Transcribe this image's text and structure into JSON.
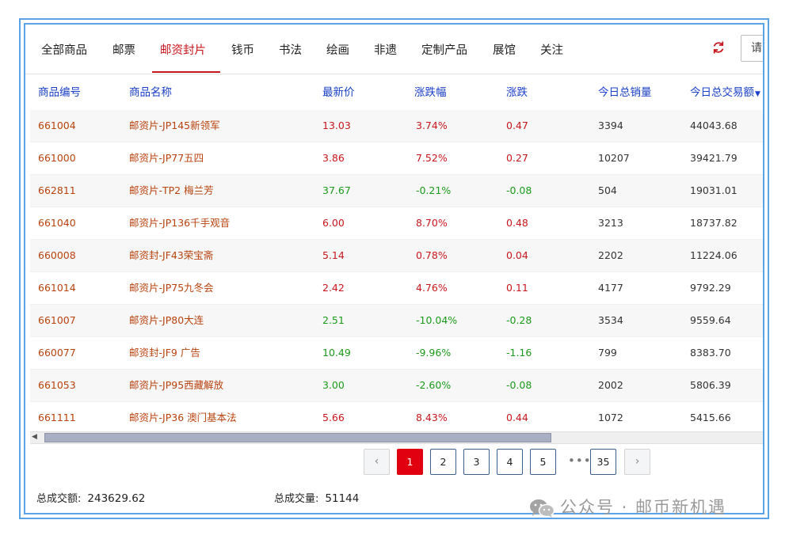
{
  "tabs": [
    {
      "label": "全部商品",
      "active": false
    },
    {
      "label": "邮票",
      "active": false
    },
    {
      "label": "邮资封片",
      "active": true
    },
    {
      "label": "钱币",
      "active": false
    },
    {
      "label": "书法",
      "active": false
    },
    {
      "label": "绘画",
      "active": false
    },
    {
      "label": "非遗",
      "active": false
    },
    {
      "label": "定制产品",
      "active": false
    },
    {
      "label": "展馆",
      "active": false
    },
    {
      "label": "关注",
      "active": false
    }
  ],
  "search": {
    "partial_text": "请"
  },
  "table": {
    "headers": [
      "商品编号",
      "商品名称",
      "最新价",
      "涨跌幅",
      "涨跌",
      "今日总销量",
      "今日总交易额"
    ],
    "rows": [
      {
        "code": "661004",
        "name": "邮资片-JP145新领军",
        "price": "13.03",
        "pct": "3.74%",
        "chg": "0.47",
        "volume": "3394",
        "amount": "44043.68",
        "dir": "up"
      },
      {
        "code": "661000",
        "name": "邮资片-JP77五四",
        "price": "3.86",
        "pct": "7.52%",
        "chg": "0.27",
        "volume": "10207",
        "amount": "39421.79",
        "dir": "up"
      },
      {
        "code": "662811",
        "name": "邮资片-TP2 梅兰芳",
        "price": "37.67",
        "pct": "-0.21%",
        "chg": "-0.08",
        "volume": "504",
        "amount": "19031.01",
        "dir": "down"
      },
      {
        "code": "661040",
        "name": "邮资片-JP136千手观音",
        "price": "6.00",
        "pct": "8.70%",
        "chg": "0.48",
        "volume": "3213",
        "amount": "18737.82",
        "dir": "up"
      },
      {
        "code": "660008",
        "name": "邮资封-JF43荣宝斋",
        "price": "5.14",
        "pct": "0.78%",
        "chg": "0.04",
        "volume": "2202",
        "amount": "11224.06",
        "dir": "up"
      },
      {
        "code": "661014",
        "name": "邮资片-JP75九冬会",
        "price": "2.42",
        "pct": "4.76%",
        "chg": "0.11",
        "volume": "4177",
        "amount": "9792.29",
        "dir": "up"
      },
      {
        "code": "661007",
        "name": "邮资片-JP80大连",
        "price": "2.51",
        "pct": "-10.04%",
        "chg": "-0.28",
        "volume": "3534",
        "amount": "9559.64",
        "dir": "down"
      },
      {
        "code": "660077",
        "name": "邮资封-JF9 广告",
        "price": "10.49",
        "pct": "-9.96%",
        "chg": "-1.16",
        "volume": "799",
        "amount": "8383.70",
        "dir": "down"
      },
      {
        "code": "661053",
        "name": "邮资片-JP95西藏解放",
        "price": "3.00",
        "pct": "-2.60%",
        "chg": "-0.08",
        "volume": "2002",
        "amount": "5806.39",
        "dir": "down"
      },
      {
        "code": "661111",
        "name": "邮资片-JP36 澳门基本法",
        "price": "5.66",
        "pct": "8.43%",
        "chg": "0.44",
        "volume": "1072",
        "amount": "5415.66",
        "dir": "up"
      }
    ]
  },
  "pagination": {
    "prev": "‹",
    "pages": [
      "1",
      "2",
      "3",
      "4",
      "5"
    ],
    "ellipsis": "•••",
    "last": "35",
    "next": "›",
    "current": "1"
  },
  "footer": {
    "total_amount_label": "总成交额:",
    "total_amount_value": "243629.62",
    "total_volume_label": "总成交量:",
    "total_volume_value": "51144"
  },
  "watermark": {
    "text": "公众号 · 邮币新机遇"
  },
  "colors": {
    "accent": "#c8161d",
    "header_text": "#1b40c8",
    "down": "#1a9a1a",
    "frame": "#5aa3e6",
    "page_active": "#e0000f"
  },
  "icons": {
    "refresh": "refresh-icon",
    "sort": "sort-desc-icon",
    "wechat": "wechat-icon"
  }
}
